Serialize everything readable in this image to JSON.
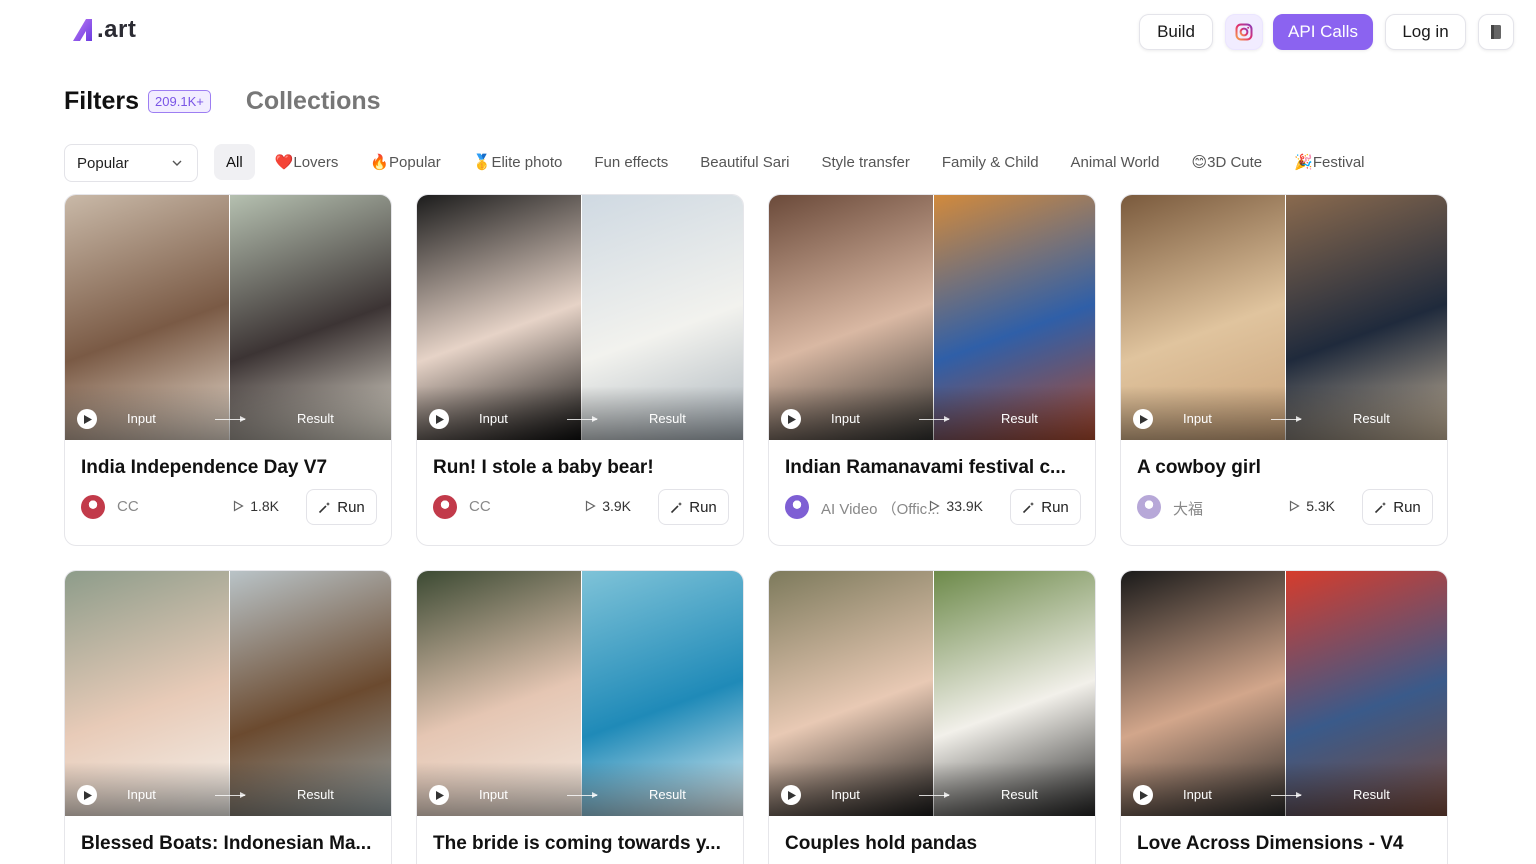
{
  "header": {
    "logo_text": ".art",
    "build_label": "Build",
    "api_label": "API Calls",
    "login_label": "Log in"
  },
  "tabs": {
    "filters_label": "Filters",
    "filters_count": "209.1K+",
    "collections_label": "Collections"
  },
  "sort": {
    "selected": "Popular"
  },
  "chips": [
    {
      "label": "All",
      "active": true
    },
    {
      "label": "❤️Lovers"
    },
    {
      "label": "🔥Popular"
    },
    {
      "label": "🥇Elite photo"
    },
    {
      "label": "Fun effects"
    },
    {
      "label": "Beautiful Sari"
    },
    {
      "label": "Style transfer"
    },
    {
      "label": "Family & Child"
    },
    {
      "label": "Animal World"
    },
    {
      "label": "😊3D Cute"
    },
    {
      "label": "🎉Festival"
    }
  ],
  "card_labels": {
    "input": "Input",
    "result": "Result",
    "run": "Run"
  },
  "cards": [
    {
      "title": "India Independence Day V7",
      "author": "CC",
      "runs": "1.8K",
      "colors": {
        "l": [
          "#c9b9a8",
          "#7a5a45",
          "#e8dccf"
        ],
        "r": [
          "#b5c0b0",
          "#3c3434",
          "#e7e2d5"
        ],
        "avatar": "#c23a4a"
      }
    },
    {
      "title": "Run! I stole a baby bear!",
      "author": "CC",
      "runs": "3.9K",
      "colors": {
        "l": [
          "#1c1c1c",
          "#e6d3c7",
          "#0e0e0e"
        ],
        "r": [
          "#cfd9e2",
          "#f2f2ee",
          "#a9b3bb"
        ],
        "avatar": "#c23a4a"
      }
    },
    {
      "title": "Indian Ramanavami festival c...",
      "author": "AI Video （Offic...",
      "runs": "33.9K",
      "colors": {
        "l": [
          "#6b4a3a",
          "#d9b8a3",
          "#30302e"
        ],
        "r": [
          "#d28a3c",
          "#2f5fa8",
          "#b04a2c"
        ],
        "avatar": "#7e5fd4"
      }
    },
    {
      "title": "A cowboy girl",
      "author": "大福",
      "runs": "5.3K",
      "colors": {
        "l": [
          "#7a5a3d",
          "#e0c49e",
          "#c9a27a"
        ],
        "r": [
          "#8a6a4e",
          "#1f2a3c",
          "#c8b59a"
        ],
        "avatar": "#b7a8d8"
      }
    },
    {
      "title": "Blessed Boats: Indonesian Ma...",
      "author": "",
      "runs": "",
      "colors": {
        "l": [
          "#8d9c8a",
          "#e8cbb8",
          "#f4f1ec"
        ],
        "r": [
          "#b9c3c7",
          "#6b4a2f",
          "#96a3a6"
        ],
        "avatar": "#999"
      }
    },
    {
      "title": "The bride is coming towards y...",
      "author": "",
      "runs": "",
      "colors": {
        "l": [
          "#3c4a33",
          "#e5c6b3",
          "#f1e7de"
        ],
        "r": [
          "#7fc3d8",
          "#1f8ab8",
          "#e7f2f5"
        ],
        "avatar": "#999"
      }
    },
    {
      "title": "Couples hold pandas",
      "author": "",
      "runs": "",
      "colors": {
        "l": [
          "#7d7a5c",
          "#e8c9b4",
          "#1a1a1a"
        ],
        "r": [
          "#6d8a4a",
          "#f2f0ea",
          "#232323"
        ],
        "avatar": "#999"
      }
    },
    {
      "title": "Love Across Dimensions - V4",
      "author": "",
      "runs": "",
      "colors": {
        "l": [
          "#1a1a1a",
          "#d2a68b",
          "#2a2a2a"
        ],
        "r": [
          "#d63c2c",
          "#3a5a8a",
          "#7a4a3a"
        ],
        "avatar": "#999"
      }
    }
  ]
}
